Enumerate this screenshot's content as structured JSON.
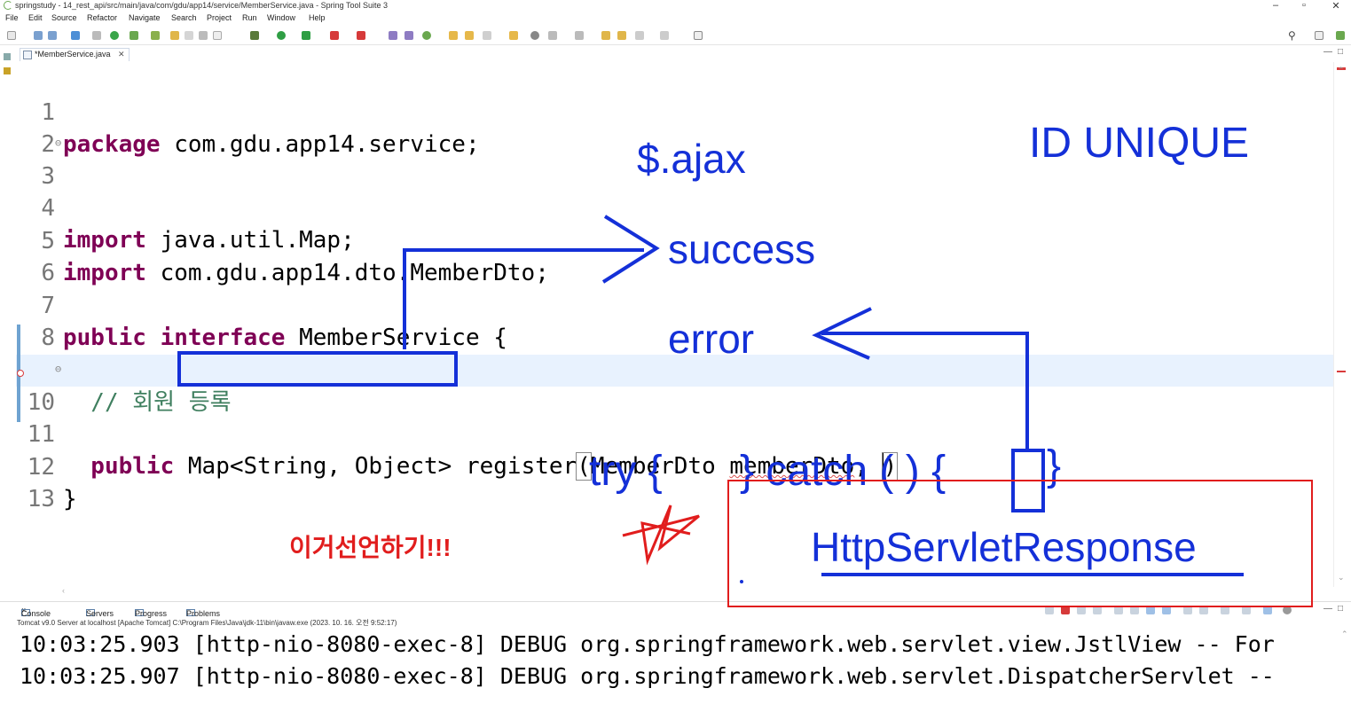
{
  "window": {
    "title": "springstudy - 14_rest_api/src/main/java/com/gdu/app14/service/MemberService.java - Spring Tool Suite 3",
    "controls": [
      "–",
      "▫",
      "✕"
    ]
  },
  "menu": [
    "File",
    "Edit",
    "Source",
    "Refactor",
    "Navigate",
    "Search",
    "Project",
    "Run",
    "Window",
    "Help"
  ],
  "editor": {
    "tab_label": "*MemberService.java",
    "tab_close": "✕",
    "lines": [
      {
        "num": "1"
      },
      {
        "num": "2"
      },
      {
        "num": "3"
      },
      {
        "num": "4"
      },
      {
        "num": "5"
      },
      {
        "num": "6"
      },
      {
        "num": "7"
      },
      {
        "num": "8"
      },
      {
        "num": "9"
      },
      {
        "num": "10"
      },
      {
        "num": "11"
      },
      {
        "num": "12"
      },
      {
        "num": "13"
      }
    ],
    "code": {
      "l1_kw": "package",
      "l1_rest": " com.gdu.app14.service;",
      "l3_kw": "import",
      "l3_rest": " java.util.Map;",
      "l5_kw": "import",
      "l5_rest": " com.gdu.app14.dto.MemberDto;",
      "l7_kw1": "public",
      "l7_kw2": "interface",
      "l7_rest": " MemberService {",
      "l9_comment": "  // 회원 등록",
      "l10_kw": "  public",
      "l10_type": " Map<String, Object>",
      "l10_method": " register",
      "l10_paren_open": "(",
      "l10_params": "MemberDto ",
      "l10_param_name": "memberDto",
      "l10_comma": ", ",
      "l10_paren_close": ")",
      "l12_brace": "}"
    }
  },
  "console": {
    "tabs": [
      "Console",
      "Servers",
      "Progress",
      "Problems"
    ],
    "description": "Tomcat v9.0 Server at localhost [Apache Tomcat] C:\\Program Files\\Java\\jdk-11\\bin\\javaw.exe  (2023. 10. 16. 오전 9:52:17)",
    "lines": [
      "10:03:25.903 [http-nio-8080-exec-8] DEBUG org.springframework.web.servlet.view.JstlView -- For",
      "10:03:25.907 [http-nio-8080-exec-8] DEBUG org.springframework.web.servlet.DispatcherServlet --"
    ]
  },
  "annotations": {
    "ajax": "$.ajax",
    "id_unique": "ID UNIQUE",
    "success": "success",
    "error": "error",
    "try": "try {",
    "catch": "} catch  ( ) {",
    "catch_close": "}",
    "http_servlet_response": "HttpServletResponse",
    "declare_note": "이거선언하기!!!"
  },
  "colors": {
    "keyword": "#7f0055",
    "comment": "#3f7f5f",
    "annotation_blue": "#1430d8",
    "annotation_red": "#e11d1d",
    "current_line": "#e8f2fe"
  }
}
